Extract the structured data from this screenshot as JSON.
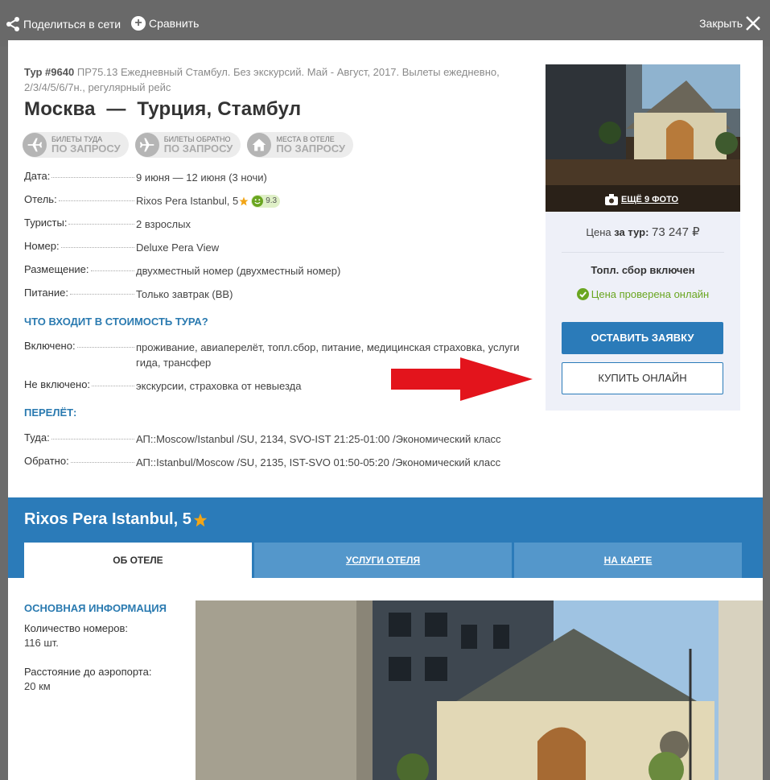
{
  "topbar": {
    "share_label": "Поделиться в сети",
    "compare_label": "Сравнить",
    "close_label": "Закрыть"
  },
  "tour": {
    "number": "Тур #9640",
    "description": "ПР75.13 Ежедневный Стамбул. Без экскурсий. Май - Август, 2017. Вылеты ежедневно, 2/3/4/5/6/7н., регулярный рейс",
    "route": "Москва  —  Турция, Стамбул"
  },
  "pills": [
    {
      "small": "БИЛЕТЫ ТУДА",
      "big": "ПО ЗАПРОСУ",
      "icon": "plane-icon"
    },
    {
      "small": "БИЛЕТЫ ОБРАТНО",
      "big": "ПО ЗАПРОСУ",
      "icon": "plane-icon"
    },
    {
      "small": "МЕСТА В ОТЕЛЕ",
      "big": "ПО ЗАПРОСУ",
      "icon": "house-icon"
    }
  ],
  "details": {
    "date_label": "Дата:",
    "date_value": "9 июня — 12 июня (3 ночи)",
    "hotel_label": "Отель:",
    "hotel_value": "Rixos Pera Istanbul, 5",
    "hotel_rating": "9.3",
    "tourists_label": "Туристы:",
    "tourists_value": "2 взрослых",
    "room_label": "Номер:",
    "room_value": "Deluxe Pera View",
    "placement_label": "Размещение:",
    "placement_value": "двухместный номер (двухместный номер)",
    "meal_label": "Питание:",
    "meal_value": "Только завтрак (BB)"
  },
  "included": {
    "heading": "ЧТО ВХОДИТ В СТОИМОСТЬ ТУРА?",
    "in_label": "Включено:",
    "in_value": "проживание, авиаперелёт, топл.сбор, питание, медицинская страховка, услуги гида, трансфер",
    "out_label": "Не включено:",
    "out_value": "экскурсии, страховка от невыезда"
  },
  "flight": {
    "heading": "ПЕРЕЛЁТ:",
    "there_label": "Туда:",
    "there_value": "АП::Moscow/Istanbul /SU, 2134, SVO-IST 21:25-01:00 /Экономический класс",
    "back_label": "Обратно:",
    "back_value": "АП::Istanbul/Moscow /SU, 2135, IST-SVO 01:50-05:20 /Экономический класс"
  },
  "card": {
    "photo_label": "ЕЩЁ 9 ФОТО",
    "price_prefix": "Цена ",
    "price_bold": "за тур:",
    "price_amount": "73 247 ₽",
    "fuel": "Топл. сбор включен",
    "checked": "Цена проверена онлайн",
    "btn_request": "ОСТАВИТЬ ЗАЯВКУ",
    "btn_buy": "КУПИТЬ ОНЛАЙН"
  },
  "hotel": {
    "name": "Rixos Pera Istanbul, 5",
    "tabs": [
      "ОБ ОТЕЛЕ",
      "УСЛУГИ ОТЕЛЯ",
      "НА КАРТЕ"
    ],
    "basic_heading": "ОСНОВНАЯ ИНФОРМАЦИЯ",
    "rooms_label": "Количество номеров:",
    "rooms_value": "116 шт.",
    "airport_label": "Расстояние до аэропорта:",
    "airport_value": "20 км"
  },
  "colors": {
    "accent": "#2b7bb9",
    "success": "#6aa621",
    "star": "#f2a516",
    "arrow": "#e3141c"
  }
}
